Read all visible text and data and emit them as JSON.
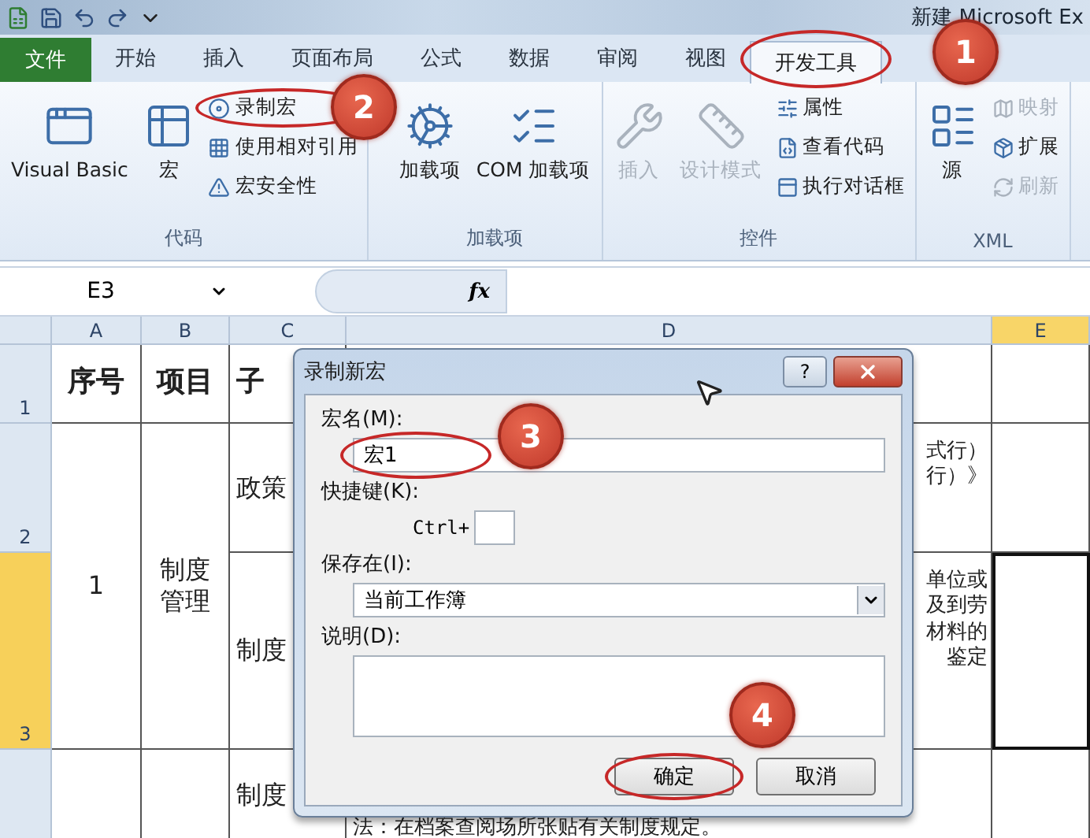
{
  "window": {
    "title": "新建 Microsoft Ex"
  },
  "ribbon_tabs": [
    {
      "label": "文件",
      "kind": "file",
      "selected": false,
      "circled": false
    },
    {
      "label": "开始",
      "kind": "tab",
      "selected": false,
      "circled": false
    },
    {
      "label": "插入",
      "kind": "tab",
      "selected": false,
      "circled": false
    },
    {
      "label": "页面布局",
      "kind": "tab",
      "selected": false,
      "circled": false
    },
    {
      "label": "公式",
      "kind": "tab",
      "selected": false,
      "circled": false
    },
    {
      "label": "数据",
      "kind": "tab",
      "selected": false,
      "circled": false
    },
    {
      "label": "审阅",
      "kind": "tab",
      "selected": false,
      "circled": false
    },
    {
      "label": "视图",
      "kind": "tab",
      "selected": false,
      "circled": false
    },
    {
      "label": "开发工具",
      "kind": "tab",
      "selected": true,
      "circled": true
    }
  ],
  "ribbon_groups": [
    {
      "label": "代码",
      "items": [
        {
          "label": "Visual Basic",
          "kind": "large",
          "disabled": false,
          "circled": false
        },
        {
          "label": "宏",
          "kind": "large",
          "disabled": false,
          "circled": false
        },
        {
          "label": "录制宏",
          "kind": "small",
          "disabled": false,
          "circled": true
        },
        {
          "label": "使用相对引用",
          "kind": "small",
          "disabled": false,
          "circled": false
        },
        {
          "label": "宏安全性",
          "kind": "small",
          "disabled": false,
          "circled": false
        }
      ]
    },
    {
      "label": "加载项",
      "items": [
        {
          "label": "加载项",
          "kind": "large",
          "disabled": false,
          "circled": false
        },
        {
          "label": "COM 加载项",
          "kind": "large",
          "disabled": false,
          "circled": false
        }
      ]
    },
    {
      "label": "控件",
      "items": [
        {
          "label": "插入",
          "kind": "large",
          "disabled": true,
          "circled": false
        },
        {
          "label": "设计模式",
          "kind": "large",
          "disabled": true,
          "circled": false
        },
        {
          "label": "属性",
          "kind": "small",
          "disabled": false,
          "circled": false
        },
        {
          "label": "查看代码",
          "kind": "small",
          "disabled": false,
          "circled": false
        },
        {
          "label": "执行对话框",
          "kind": "small",
          "disabled": false,
          "circled": false
        }
      ]
    },
    {
      "label": "XML",
      "items": [
        {
          "label": "源",
          "kind": "large",
          "disabled": false,
          "circled": false
        },
        {
          "label": "映射",
          "kind": "small",
          "disabled": true,
          "circled": false
        },
        {
          "label": "扩展",
          "kind": "small",
          "disabled": false,
          "circled": false
        },
        {
          "label": "刷新",
          "kind": "small",
          "disabled": true,
          "circled": false
        }
      ]
    }
  ],
  "formula_bar": {
    "name_box": "E3",
    "function_label": "fx"
  },
  "sheet": {
    "columns": [
      {
        "label": "A",
        "selected": false
      },
      {
        "label": "B",
        "selected": false
      },
      {
        "label": "C",
        "selected": false
      },
      {
        "label": "D",
        "selected": false
      },
      {
        "label": "E",
        "selected": true
      }
    ],
    "rows": [
      {
        "label": "1",
        "selected": false,
        "cells": [
          {
            "kind": "text",
            "bold": true,
            "lines": [
              "序号"
            ]
          },
          {
            "kind": "text",
            "bold": true,
            "lines": [
              "项目"
            ]
          },
          {
            "kind": "text",
            "bold": true,
            "lines": [
              "子"
            ]
          },
          {
            "kind": "blank"
          },
          {
            "kind": "blank"
          }
        ]
      },
      {
        "label": "2",
        "selected": false,
        "cells": [
          {
            "kind": "text",
            "bold": false,
            "lines": [
              "1"
            ]
          },
          {
            "kind": "text",
            "bold": false,
            "lines": [
              "制度",
              "管理"
            ]
          },
          {
            "kind": "text",
            "bold": false,
            "lines": [
              "政策"
            ]
          },
          {
            "kind": "text",
            "bold": false,
            "lines": [
              "式行）",
              "行）》"
            ]
          },
          {
            "kind": "blank"
          }
        ]
      },
      {
        "label": "3",
        "selected": true,
        "cells": [
          {
            "kind": "covered"
          },
          {
            "kind": "covered"
          },
          {
            "kind": "text",
            "bold": false,
            "lines": [
              "制度"
            ]
          },
          {
            "kind": "text",
            "bold": false,
            "lines": [
              "单位或",
              "及到劳",
              "材料的",
              "鉴定"
            ]
          },
          {
            "kind": "blank"
          }
        ]
      },
      {
        "selected": false,
        "cells": [
          {
            "kind": "blank"
          },
          {
            "kind": "blank"
          },
          {
            "kind": "text",
            "bold": false,
            "lines": [
              "制度"
            ]
          },
          {
            "kind": "text",
            "bold": false,
            "lines": [
              "法：在档案查阅场所张贴有关制度规定。"
            ]
          },
          {
            "kind": "blank"
          }
        ]
      }
    ]
  },
  "dialog": {
    "title": "录制新宏",
    "help": "?",
    "fields": [
      {
        "kind": "text",
        "label": "宏名(M):",
        "value": "宏1",
        "circled": true
      },
      {
        "kind": "shortcut",
        "label": "快捷键(K):",
        "prefix": "Ctrl+",
        "circled": false
      },
      {
        "kind": "select",
        "label": "保存在(I):",
        "value": "当前工作簿",
        "circled": false
      },
      {
        "kind": "textarea",
        "label": "说明(D):",
        "circled": false
      }
    ],
    "buttons": [
      {
        "label": "确定",
        "circled": true
      },
      {
        "label": "取消",
        "circled": false
      }
    ]
  },
  "callouts": [
    {
      "number": "1"
    },
    {
      "number": "2"
    },
    {
      "number": "3"
    },
    {
      "number": "4"
    }
  ]
}
